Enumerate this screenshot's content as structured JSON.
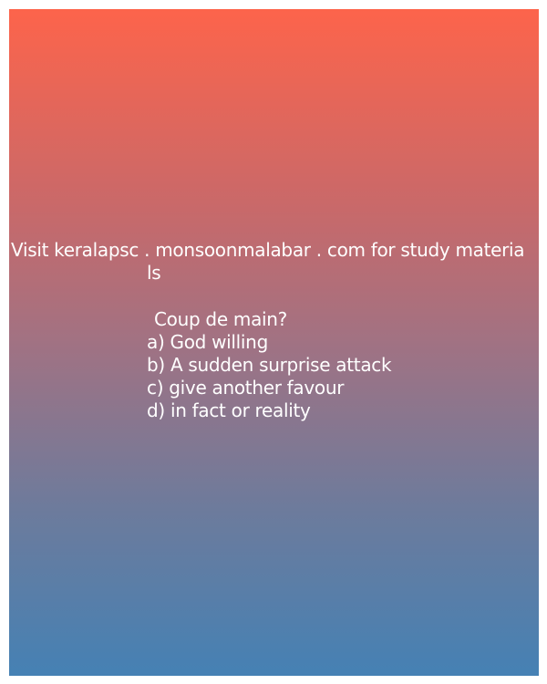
{
  "promo": {
    "line1": "Visit keralapsc . monsoonmalabar . com for study materia",
    "line2": "ls"
  },
  "question": {
    "text": "Coup de main?",
    "options": [
      "a) God willing",
      "b) A sudden surprise attack",
      "c) give another favour",
      "d) in fact or reality"
    ]
  }
}
